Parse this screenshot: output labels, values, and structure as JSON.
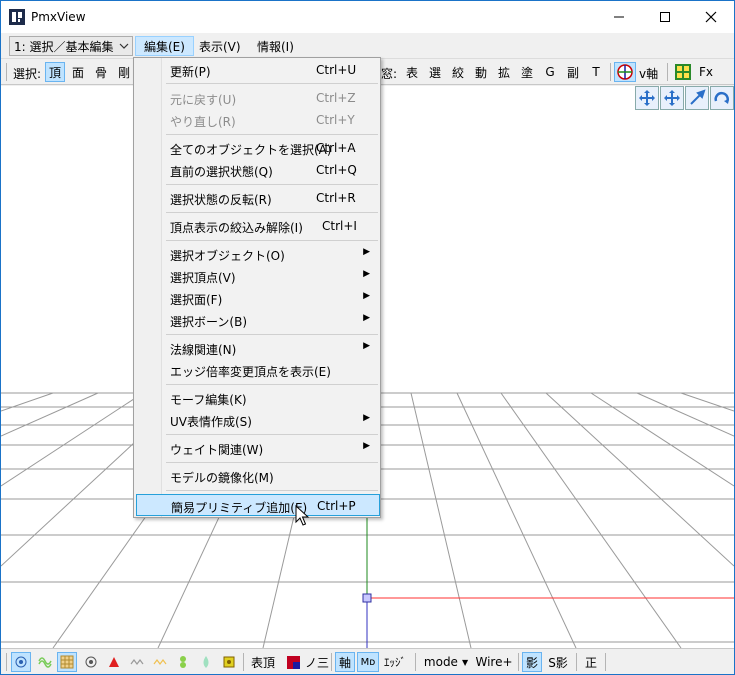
{
  "window": {
    "title": "PmxView"
  },
  "menubar": {
    "mode_select": "1: 選択／基本編集",
    "menus": [
      {
        "label": "編集(E)"
      },
      {
        "label": "表示(V)"
      },
      {
        "label": "情報(I)"
      }
    ]
  },
  "toolbar": {
    "select_label": "選択:",
    "select_buttons": [
      "頂",
      "面",
      "骨",
      "剛"
    ],
    "window_label": "窓:",
    "window_buttons": [
      "表",
      "選",
      "絞",
      "動",
      "拡",
      "塗",
      "G",
      "副",
      "T"
    ],
    "v_axis_label": "v軸",
    "fx_label": "Fx"
  },
  "edit_menu": {
    "items": [
      {
        "label": "更新(P)",
        "shortcut": "Ctrl+U"
      },
      {
        "label": "元に戻す(U)",
        "shortcut": "Ctrl+Z",
        "disabled": true
      },
      {
        "label": "やり直し(R)",
        "shortcut": "Ctrl+Y",
        "disabled": true
      },
      {
        "label": "全てのオブジェクトを選択(A)",
        "shortcut": "Ctrl+A"
      },
      {
        "label": "直前の選択状態(Q)",
        "shortcut": "Ctrl+Q"
      },
      {
        "label": "選択状態の反転(R)",
        "shortcut": "Ctrl+R"
      },
      {
        "label": "頂点表示の絞込み解除(I)",
        "shortcut": "Ctrl+I"
      },
      {
        "label": "選択オブジェクト(O)",
        "submenu": true
      },
      {
        "label": "選択頂点(V)",
        "submenu": true
      },
      {
        "label": "選択面(F)",
        "submenu": true
      },
      {
        "label": "選択ボーン(B)",
        "submenu": true
      },
      {
        "label": "法線関連(N)",
        "submenu": true
      },
      {
        "label": "エッジ倍率変更頂点を表示(E)"
      },
      {
        "label": "モーフ編集(K)"
      },
      {
        "label": "UV表情作成(S)",
        "submenu": true
      },
      {
        "label": "ウェイト関連(W)",
        "submenu": true
      },
      {
        "label": "モデルの鏡像化(M)"
      },
      {
        "label": "簡易プリミティブ追加(E)",
        "shortcut": "Ctrl+P",
        "highlighted": true
      }
    ]
  },
  "statusbar": {
    "hyouchou": "表頂",
    "nomi": "ノ三",
    "jiku": "軸",
    "md": "Mᴅ",
    "edge": "ｴｯｼﾞ",
    "mode": "mode",
    "wire": "Wire+",
    "kage": "影",
    "s_kage": "S影",
    "sei": "正"
  },
  "colors": {
    "accent": "#1a73c8",
    "highlight": "#cce8ff",
    "axis_x": "#ff3030",
    "axis_y": "#1e8a1e",
    "axis_z": "#3030c0"
  }
}
